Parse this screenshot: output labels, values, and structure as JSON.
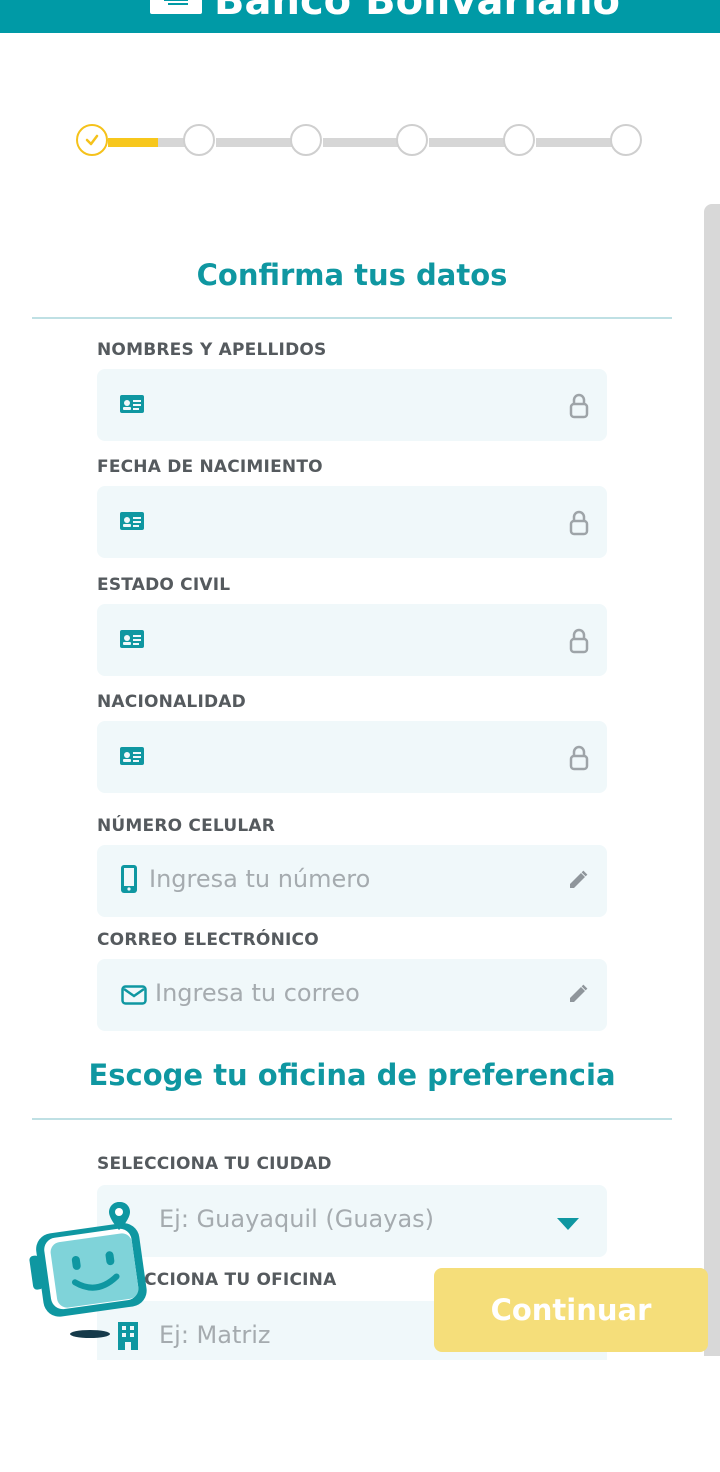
{
  "header": {
    "brand_name": "Banco Bolivariano",
    "background_color": "#009aa6"
  },
  "stepper": {
    "total_steps": 6,
    "completed_steps": 1,
    "current_step": 1,
    "progress_color": "#f7c71c"
  },
  "personal_section": {
    "title": "Confirma tus datos",
    "fields": [
      {
        "label": "NOMBRES Y APELLIDOS",
        "value": "",
        "left_icon": "id-card-icon",
        "right_icon": "lock-icon"
      },
      {
        "label": "FECHA DE NACIMIENTO",
        "value": "",
        "left_icon": "id-card-icon",
        "right_icon": "lock-icon"
      },
      {
        "label": "ESTADO CIVIL",
        "value": "",
        "left_icon": "id-card-icon",
        "right_icon": "lock-icon"
      },
      {
        "label": "NACIONALIDAD",
        "value": "",
        "left_icon": "id-card-icon",
        "right_icon": "lock-icon"
      },
      {
        "label": "NÚMERO CELULAR",
        "placeholder": "Ingresa tu número",
        "left_icon": "mobile-phone-icon",
        "right_icon": "pencil-icon"
      },
      {
        "label": "CORREO ELECTRÓNICO",
        "placeholder": "Ingresa tu correo",
        "left_icon": "envelope-icon",
        "right_icon": "pencil-icon"
      }
    ]
  },
  "office_section": {
    "title": "Escoge tu oficina de preferencia",
    "fields": [
      {
        "label": "SELECCIONA TU CIUDAD",
        "placeholder": "Ej: Guayaquil (Guayas)",
        "left_icon": "map-pin-icon",
        "right_icon": "caret-down-icon"
      },
      {
        "label": "SELECCIONA TU OFICINA",
        "placeholder": "Ej: Matriz",
        "left_icon": "building-icon",
        "right_icon": "caret-down-icon"
      }
    ]
  },
  "actions": {
    "continue_label": "Continuar",
    "continue_color": "#f5de7a"
  },
  "colors": {
    "accent": "#0f97a1",
    "field_bg": "#f0f8fa",
    "label": "#555a5e"
  }
}
